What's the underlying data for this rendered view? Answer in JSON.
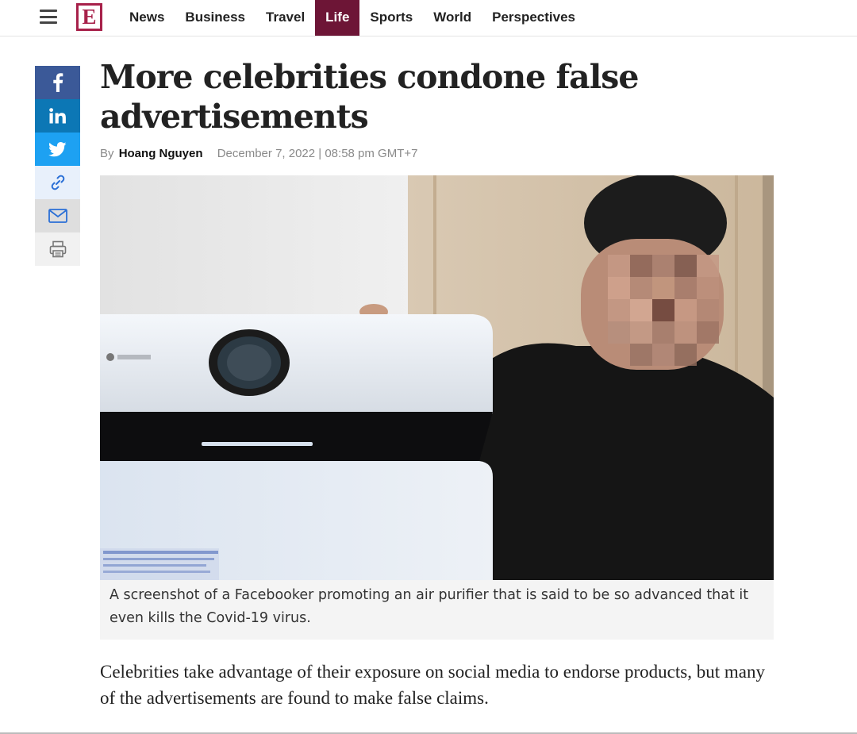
{
  "header": {
    "logo": "E",
    "nav": [
      "News",
      "Business",
      "Travel",
      "Life",
      "Sports",
      "World",
      "Perspectives"
    ],
    "active_nav": "Life"
  },
  "share": {
    "buttons": [
      "facebook-icon",
      "linkedin-icon",
      "twitter-icon",
      "link-icon",
      "mail-icon",
      "print-icon"
    ]
  },
  "article": {
    "title": "More celebrities condone false advertisements",
    "byline_prefix": "By",
    "author": "Hoang Nguyen",
    "date": "December 7, 2022 | 08:58 pm GMT+7",
    "caption": "A screenshot of a Facebooker promoting an air purifier that is said to be so advanced that it even kills the Covid-19 virus.",
    "lead": "Celebrities take advantage of their exposure on social media to endorse products, but many of the advertisements are found to make false claims."
  },
  "colors": {
    "brand": "#a7214a",
    "active_nav_bg": "#6d1536",
    "facebook": "#3b5998",
    "linkedin": "#0c77b5",
    "twitter": "#1da1f2"
  }
}
